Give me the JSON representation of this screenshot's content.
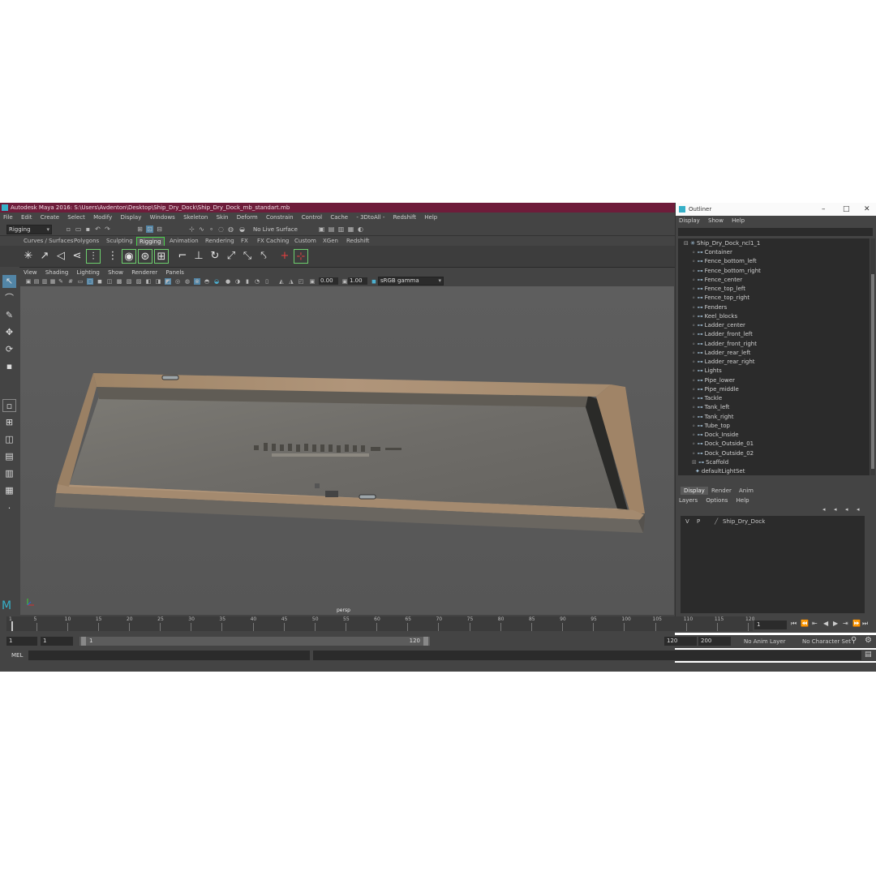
{
  "window": {
    "title": "Autodesk Maya 2016: S:\\Users\\Avdenton\\Desktop\\Ship_Dry_Dock\\Ship_Dry_Dock_mb_standart.mb"
  },
  "menubar": {
    "items": [
      "File",
      "Edit",
      "Create",
      "Select",
      "Modify",
      "Display",
      "Windows",
      "Skeleton",
      "Skin",
      "Deform",
      "Constrain",
      "Control",
      "Cache",
      "- 3DtoAll -",
      "Redshift",
      "Help"
    ]
  },
  "statusline": {
    "menuset": "Rigging",
    "live_surface": "No Live Surface"
  },
  "shelf": {
    "tabs": [
      "Curves / Surfaces",
      "Polygons",
      "Sculpting",
      "Rigging",
      "Animation",
      "Rendering",
      "FX",
      "FX Caching",
      "Custom",
      "XGen",
      "Redshift"
    ],
    "active_tab": "Rigging"
  },
  "viewport": {
    "menu": [
      "View",
      "Shading",
      "Lighting",
      "Show",
      "Renderer",
      "Panels"
    ],
    "exposure": "0.00",
    "gamma": "1.00",
    "color_space": "sRGB gamma",
    "camera_label": "persp"
  },
  "timeline": {
    "ticks": [
      "1",
      "5",
      "10",
      "15",
      "20",
      "25",
      "30",
      "35",
      "40",
      "45",
      "50",
      "55",
      "60",
      "65",
      "70",
      "75",
      "80",
      "85",
      "90",
      "95",
      "100",
      "105",
      "110",
      "115",
      "120"
    ],
    "current_frame": "1"
  },
  "range": {
    "start": "1",
    "playback_start": "1",
    "slider_start": "1",
    "slider_end": "120",
    "playback_end": "120",
    "end": "200",
    "anim_layer": "No Anim Layer",
    "character_set": "No Character Set"
  },
  "cmdline": {
    "label": "MEL"
  },
  "outliner": {
    "title": "Outliner",
    "menu": [
      "Display",
      "Show",
      "Help"
    ],
    "root": "Ship_Dry_Dock_ncl1_1",
    "children": [
      "Container",
      "Fence_bottom_left",
      "Fence_bottom_right",
      "Fence_center",
      "Fence_top_left",
      "Fence_top_right",
      "Fenders",
      "Keel_blocks",
      "Ladder_center",
      "Ladder_front_left",
      "Ladder_front_right",
      "Ladder_rear_left",
      "Ladder_rear_right",
      "Lights",
      "Pipe_lower",
      "Pipe_middle",
      "Tackle",
      "Tank_left",
      "Tank_right",
      "Tube_top",
      "Dock_Inside",
      "Dock_Outside_01",
      "Dock_Outside_02",
      "Scaffold"
    ],
    "last_item": "defaultLightSet"
  },
  "layers": {
    "tabs": [
      "Display",
      "Render",
      "Anim"
    ],
    "active_tab": "Display",
    "menu": [
      "Layers",
      "Options",
      "Help"
    ],
    "rows": [
      {
        "v": "V",
        "p": "P",
        "name": "Ship_Dry_Dock"
      }
    ]
  }
}
